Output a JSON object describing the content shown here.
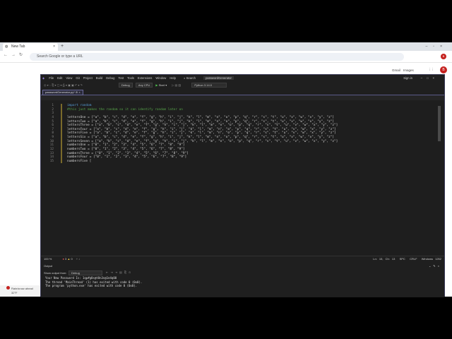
{
  "browser": {
    "tab_title": "New Tab",
    "omnibox_placeholder": "Search Google or type a URL",
    "links": [
      "Gmail",
      "Images"
    ],
    "avatar_letter": "B"
  },
  "vs": {
    "menu": [
      "File",
      "Edit",
      "View",
      "Git",
      "Project",
      "Build",
      "Debug",
      "Test",
      "Tools",
      "Extensions",
      "Window",
      "Help"
    ],
    "search_label": "Search",
    "solution_name": "passwordGenerator",
    "sign_in": "Sign in",
    "toolbar": {
      "config": "Debug",
      "platform": "Any CPU",
      "start": "Start",
      "interpreter": "Python 3.14.0"
    },
    "file_tab": "passwordGenerator.py*",
    "lines": [
      {
        "n": "1",
        "t": "import random",
        "cls": "kw"
      },
      {
        "n": "2",
        "t": "#this just makes the random so it can identify random later on",
        "cls": "cm"
      },
      {
        "n": "3",
        "t": "",
        "cls": ""
      },
      {
        "n": "4",
        "t": "lettersOne = [\"a\", \"b\", \"c\", \"d\", \"e\", \"f\", \"g\", \"h\", \"i\", \"j\", \"k\", \"l\", \"m\", \"n\", \"o\", \"p\", \"q\", \"r\", \"s\", \"t\", \"u\", \"v\", \"w\", \"x\", \"y\", \"z\"]",
        "cls": ""
      },
      {
        "n": "5",
        "t": "lettersTwo = [\"a\", \"b\", \"c\", \"d\", \"e\", \"f\", \"g\", \"h\", \"i\", \"j\", \"k\", \"l\", \"m\", \"n\", \"o\", \"p\", \"q\", \"r\", \"s\", \"t\", \"u\", \"v\", \"w\", \"x\", \"y\", \"z\"]",
        "cls": ""
      },
      {
        "n": "6",
        "t": "lettersThree = [\"a\", \"b\", \"c\", \"d\", \"e\", \"f\", \"g\", \"h\", \"i\", \"j\", \"k\", \"l\", \"m\", \"n\", \"o\", \"p\", \"q\", \"r\", \"s\", \"t\", \"u\", \"v\", \"w\", \"x\", \"y\", \"z\"]",
        "cls": ""
      },
      {
        "n": "7",
        "t": "lettersFour = [\"a\", \"b\", \"c\", \"d\", \"e\", \"f\", \"g\", \"h\", \"i\", \"j\", \"k\", \"l\", \"m\", \"n\", \"o\", \"p\", \"q\", \"r\", \"s\", \"t\", \"u\", \"v\", \"w\", \"x\", \"y\", \"z\"]",
        "cls": ""
      },
      {
        "n": "8",
        "t": "lettersFive = [\"a\", \"b\", \"c\", \"d\", \"e\", \"f\", \"g\", \"h\", \"i\", \"j\", \"k\", \"l\", \"m\", \"n\", \"o\", \"p\", \"q\", \"r\", \"s\", \"t\", \"u\", \"v\", \"w\", \"x\", \"y\", \"z\"]",
        "cls": ""
      },
      {
        "n": "9",
        "t": "lettersSix = [\"a\", \"b\", \"c\", \"d\", \"e\", \"f\", \"g\", \"h\", \"i\", \"j\", \"k\", \"l\", \"m\", \"n\", \"o\", \"p\", \"q\", \"r\", \"s\", \"t\", \"u\", \"v\", \"w\", \"x\", \"y\", \"z\"]",
        "cls": ""
      },
      {
        "n": "10",
        "t": "lettersSeven = [\"a\", \"b\", \"c\", \"d\", \"e\", \"f\", \"g\", \"h\", \"i\", \"j\", \"k\", \"l\", \"m\", \"n\", \"o\", \"p\", \"q\", \"r\", \"s\", \"t\", \"u\", \"v\", \"w\", \"x\", \"y\", \"z\"]",
        "cls": ""
      },
      {
        "n": "11",
        "t": "numbersOne = [\"0\", \"1\", \"2\", \"3\", \"4\", \"5\", \"6\", \"7\", \"8\", \"9\"]",
        "cls": ""
      },
      {
        "n": "12",
        "t": "numbersTwo = [\"0\", \"1\", \"2\", \"3\", \"4\", \"5\", \"6\", \"7\", \"8\", \"9\"]",
        "cls": ""
      },
      {
        "n": "13",
        "t": "numbersThree = [\"0\", \"1\", \"2\", \"3\", \"4\", \"5\", \"6\", \"7\", \"8\", \"9\"]",
        "cls": ""
      },
      {
        "n": "14",
        "t": "numbersFour = [\"0\", \"1\", \"2\", \"3\", \"4\", \"5\", \"6\", \"7\", \"8\", \"9\"]",
        "cls": ""
      },
      {
        "n": "15",
        "t": "numbersFive [",
        "cls": ""
      }
    ],
    "status": {
      "zoom": "100 %",
      "errors": "3",
      "warnings": "0",
      "position": "Ln: 15, Ch: 13",
      "spc": "SPC",
      "eol": "CRLF",
      "encoding": "Windows 1252"
    },
    "output": {
      "title": "Output",
      "show_from_label": "Show output from:",
      "source": "Debug",
      "lines": [
        "Your New Password Is: 1qp#g8s@t8n3v@1e4q00",
        "The thread 'MainThread' (1) has exited with code 0 (0x0).",
        "The program 'python.exe' has exited with code 0 (0x0)."
      ]
    }
  },
  "weather": {
    "title": "Rain/snow ahead",
    "temp": "32°F"
  }
}
